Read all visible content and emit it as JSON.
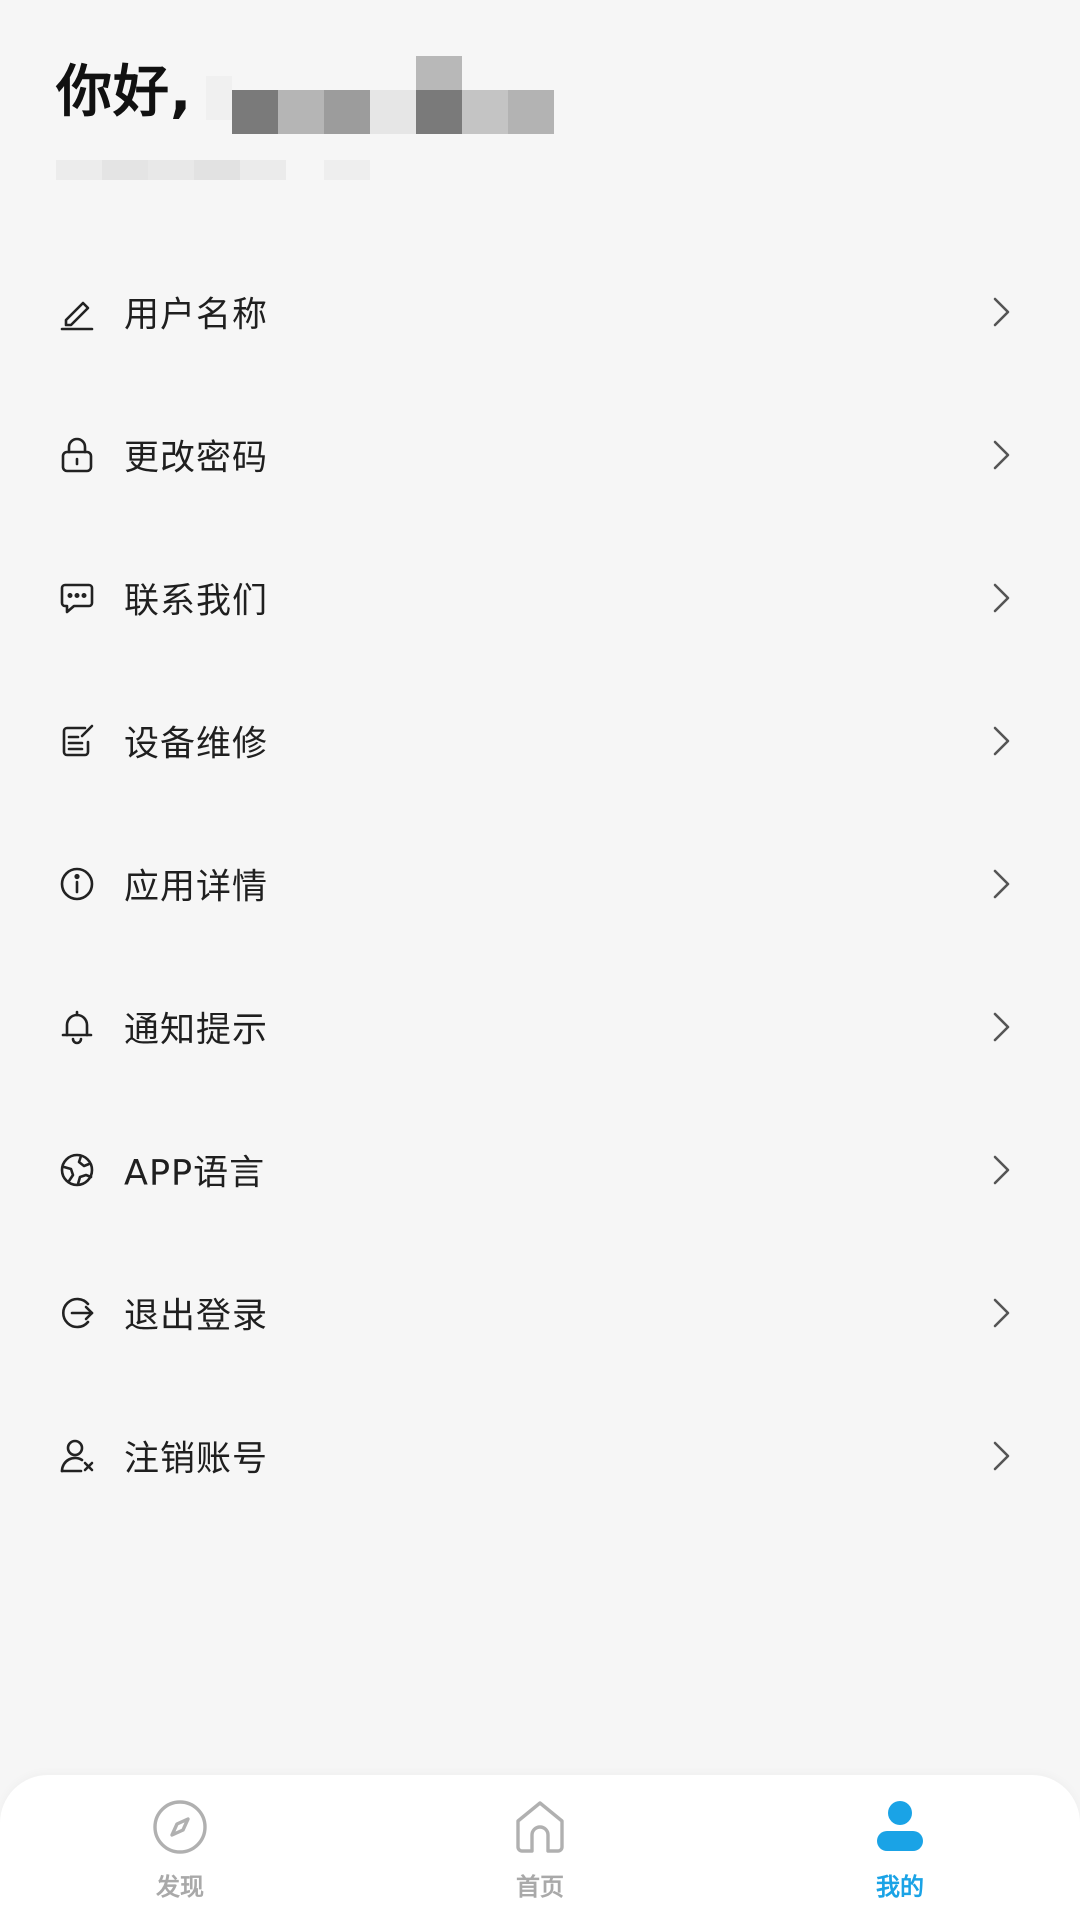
{
  "header": {
    "greeting": "你好,"
  },
  "menu": {
    "items": [
      {
        "label": "用户名称",
        "icon": "pencil-icon"
      },
      {
        "label": "更改密码",
        "icon": "lock-icon"
      },
      {
        "label": "联系我们",
        "icon": "chat-bubble-icon"
      },
      {
        "label": "设备维修",
        "icon": "edit-note-icon"
      },
      {
        "label": "应用详情",
        "icon": "info-icon"
      },
      {
        "label": "通知提示",
        "icon": "bell-icon"
      },
      {
        "label": "APP语言",
        "icon": "globe-icon"
      },
      {
        "label": "退出登录",
        "icon": "logout-icon"
      },
      {
        "label": "注销账号",
        "icon": "user-remove-icon"
      }
    ],
    "chevron_icon": "chevron-right-icon"
  },
  "tabbar": {
    "tabs": [
      {
        "label": "发现",
        "icon": "compass-icon",
        "active": false
      },
      {
        "label": "首页",
        "icon": "home-icon",
        "active": false
      },
      {
        "label": "我的",
        "icon": "user-icon",
        "active": true
      }
    ],
    "active_color": "#1aa3e6",
    "inactive_color": "#a9a9a9"
  }
}
